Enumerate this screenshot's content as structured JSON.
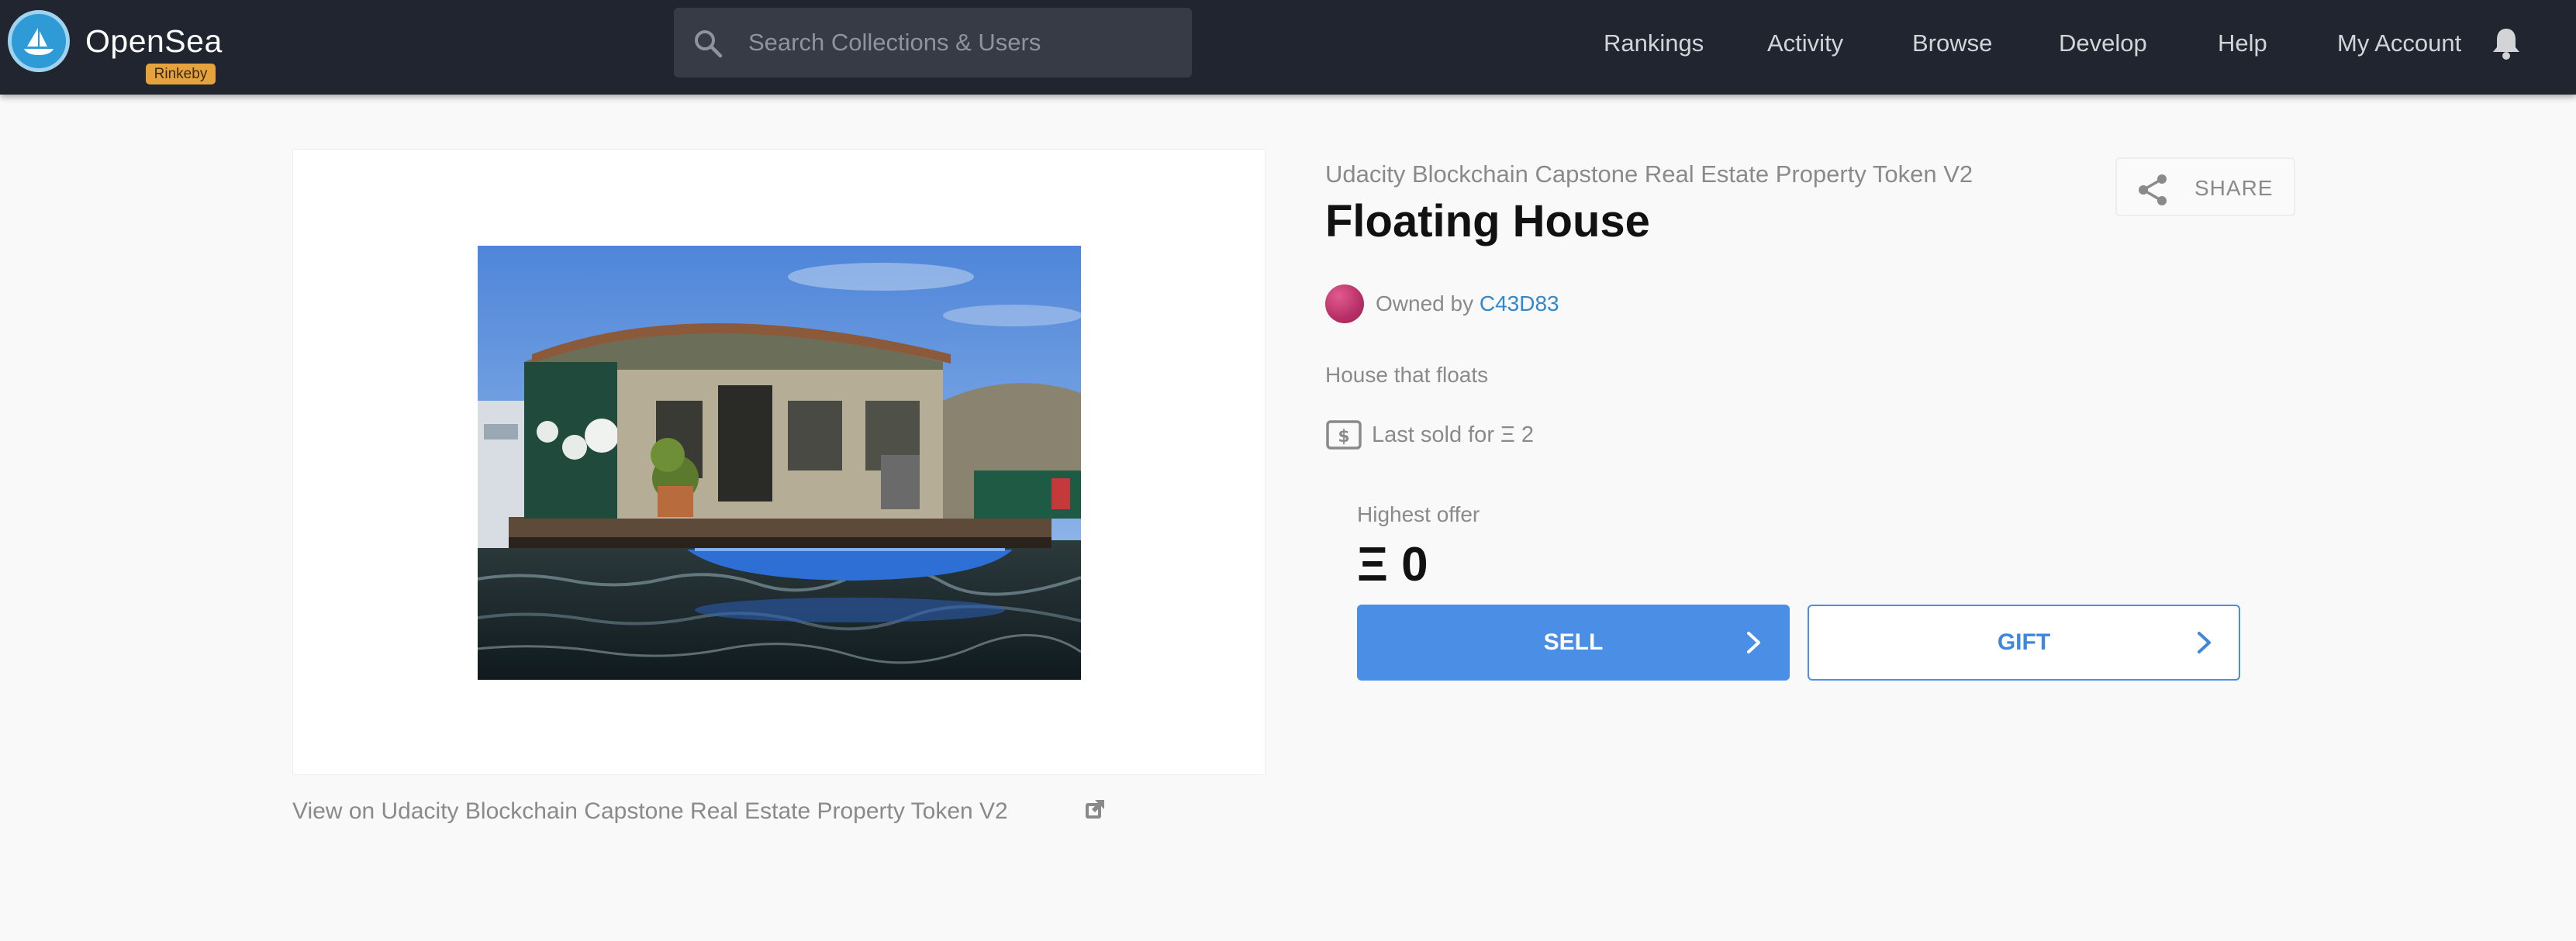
{
  "navbar": {
    "brand": "OpenSea",
    "network_badge": "Rinkeby",
    "search_placeholder": "Search Collections & Users",
    "links": [
      "Rankings",
      "Activity",
      "Browse",
      "Develop",
      "Help",
      "My Account"
    ]
  },
  "asset": {
    "collection_name": "Udacity Blockchain Capstone Real Estate Property Token V2",
    "title": "Floating House",
    "owned_by_label": "Owned by",
    "owner": "C43D83",
    "description": "House that floats",
    "last_sold": "Last sold for Ξ 2",
    "share_label": "SHARE",
    "view_link": "View on Udacity Blockchain Capstone Real Estate Property Token V2"
  },
  "offer": {
    "label": "Highest offer",
    "value": "Ξ 0"
  },
  "actions": {
    "sell_label": "SELL",
    "gift_label": "GIFT"
  },
  "colors": {
    "navbar_bg": "#202530",
    "accent_blue": "#4a8ee6",
    "owner_link": "#2f88d2",
    "badge": "#e6a23c"
  }
}
